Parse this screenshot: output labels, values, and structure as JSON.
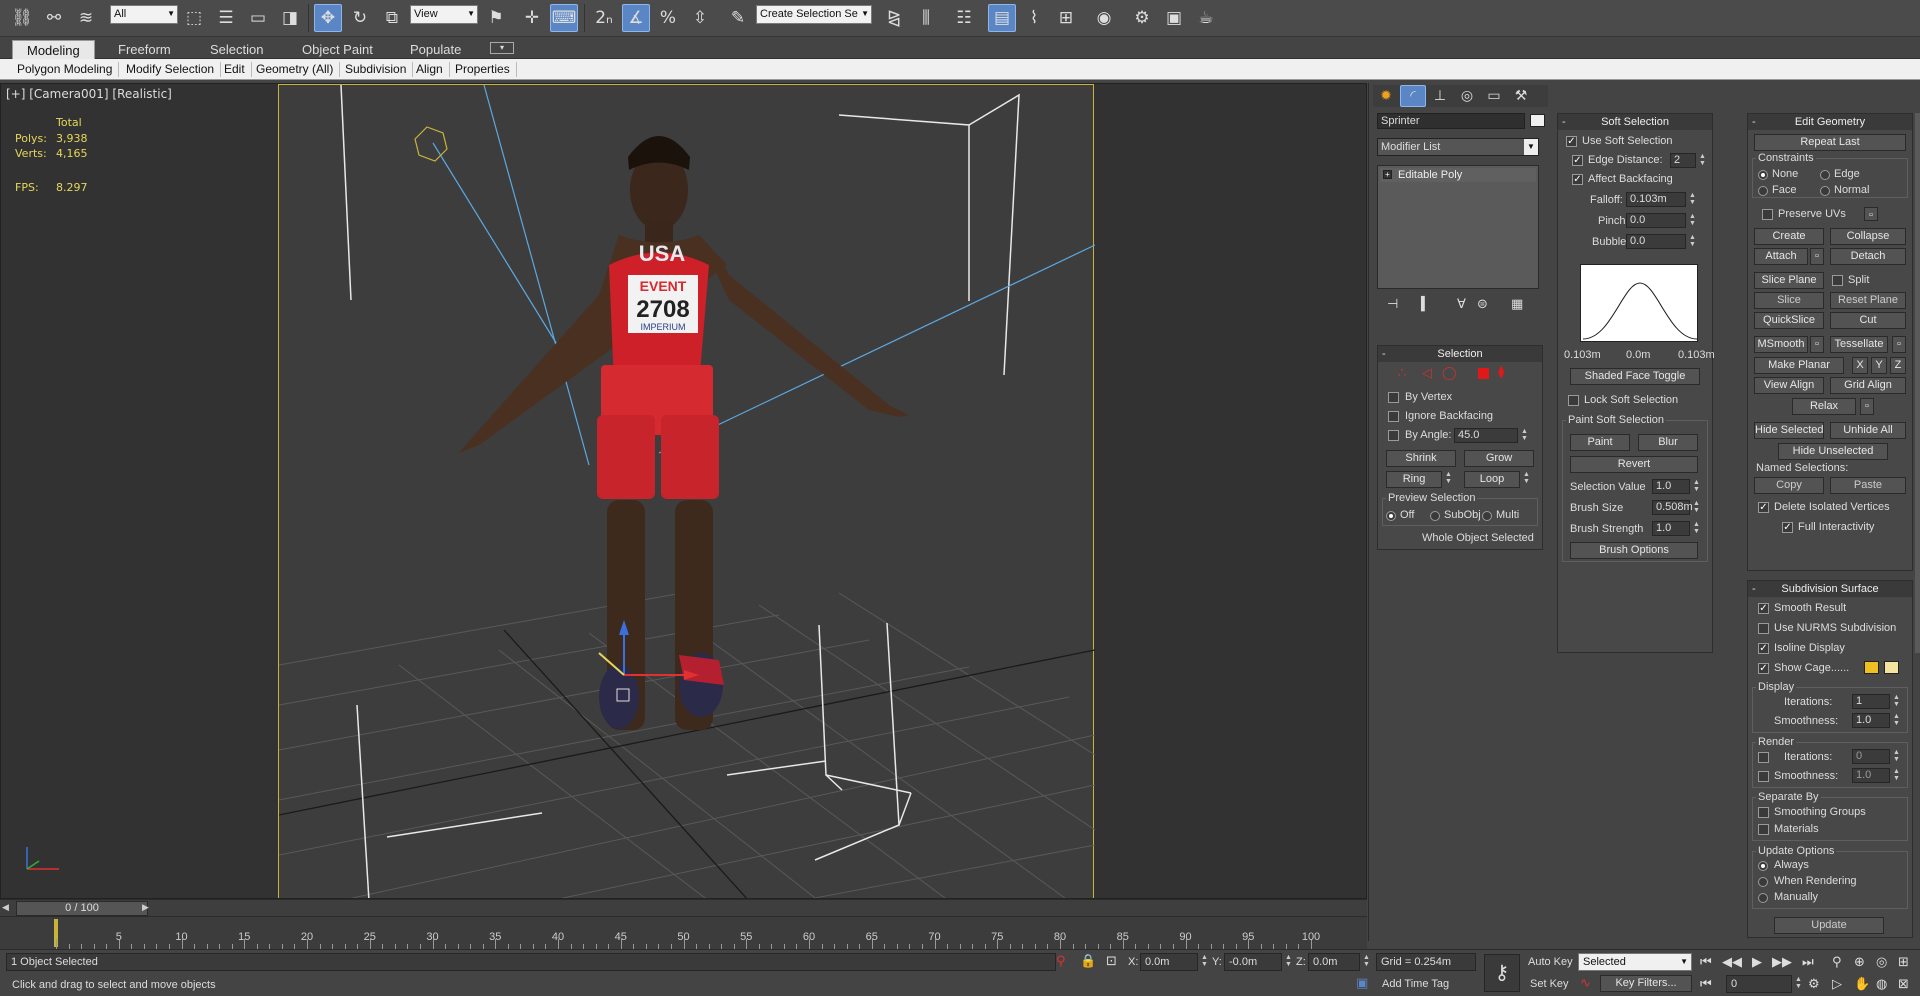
{
  "toolbar": {
    "selection_filter": "All",
    "ref_coord": "View",
    "named_selection_placeholder": "Create Selection Se"
  },
  "ribbon": {
    "tabs": [
      "Modeling",
      "Freeform",
      "Selection",
      "Object Paint",
      "Populate"
    ],
    "sub": [
      "Polygon Modeling",
      "Modify Selection",
      "Edit",
      "Geometry (All)",
      "Subdivision",
      "Align",
      "Properties"
    ]
  },
  "viewport": {
    "label": "[+] [Camera001] [Realistic]",
    "stats": {
      "total": "Total",
      "polys_label": "Polys:",
      "polys": "3,938",
      "verts_label": "Verts:",
      "verts": "4,165",
      "fps_label": "FPS:",
      "fps": "8.297"
    },
    "jersey": {
      "country": "USA",
      "event": "EVENT",
      "number": "2708",
      "sponsor": "IMPERIUM"
    }
  },
  "command_panel": {
    "object_name": "Sprinter",
    "modifier_list": "Modifier List",
    "stack_item": "Editable Poly",
    "selection": {
      "title": "Selection",
      "by_vertex": "By Vertex",
      "ignore_backfacing": "Ignore Backfacing",
      "by_angle": "By Angle:",
      "angle": "45.0",
      "shrink": "Shrink",
      "grow": "Grow",
      "ring": "Ring",
      "loop": "Loop",
      "preview": "Preview Selection",
      "off": "Off",
      "subobj": "SubObj",
      "multi": "Multi",
      "status": "Whole Object Selected"
    },
    "soft_selection": {
      "title": "Soft Selection",
      "use": "Use Soft Selection",
      "edge_distance": "Edge Distance:",
      "edge_value": "2",
      "affect_backfacing": "Affect Backfacing",
      "falloff": "Falloff:",
      "falloff_val": "0.103m",
      "pinch": "Pinch:",
      "pinch_val": "0.0",
      "bubble": "Bubble:",
      "bubble_val": "0.0",
      "curve_left": "0.103m",
      "curve_mid": "0.0m",
      "curve_right": "0.103m",
      "shaded_toggle": "Shaded Face Toggle",
      "lock": "Lock Soft Selection",
      "paint_group": "Paint Soft Selection",
      "paint": "Paint",
      "blur": "Blur",
      "revert": "Revert",
      "sel_value": "Selection Value",
      "sel_value_val": "1.0",
      "brush_size": "Brush Size",
      "brush_size_val": "0.508m",
      "brush_strength": "Brush Strength",
      "brush_strength_val": "1.0",
      "brush_options": "Brush Options"
    },
    "edit_geometry": {
      "title": "Edit Geometry",
      "repeat_last": "Repeat Last",
      "constraints": "Constraints",
      "none": "None",
      "edge": "Edge",
      "face": "Face",
      "normal": "Normal",
      "preserve_uvs": "Preserve UVs",
      "create": "Create",
      "collapse": "Collapse",
      "attach": "Attach",
      "detach": "Detach",
      "slice_plane": "Slice Plane",
      "split": "Split",
      "slice": "Slice",
      "reset_plane": "Reset Plane",
      "quickslice": "QuickSlice",
      "cut": "Cut",
      "msmooth": "MSmooth",
      "tessellate": "Tessellate",
      "make_planar": "Make Planar",
      "x": "X",
      "y": "Y",
      "z": "Z",
      "view_align": "View Align",
      "grid_align": "Grid Align",
      "relax": "Relax",
      "hide_selected": "Hide Selected",
      "unhide_all": "Unhide All",
      "hide_unselected": "Hide Unselected",
      "named_selections": "Named Selections:",
      "copy": "Copy",
      "paste": "Paste",
      "delete_isolated": "Delete Isolated Vertices",
      "full_interactivity": "Full Interactivity"
    },
    "subdivision_surface": {
      "title": "Subdivision Surface",
      "smooth_result": "Smooth Result",
      "use_nurms": "Use NURMS Subdivision",
      "isoline": "Isoline Display",
      "show_cage": "Show Cage......",
      "cage_color_1": "#f0c020",
      "cage_color_2": "#f3e2a0",
      "display": "Display",
      "iterations": "Iterations:",
      "iterations_val": "1",
      "smoothness": "Smoothness:",
      "smoothness_val": "1.0",
      "render": "Render",
      "r_iterations_val": "0",
      "r_smoothness_val": "1.0",
      "separate_by": "Separate By",
      "smoothing_groups": "Smoothing Groups",
      "materials": "Materials",
      "update_options": "Update Options",
      "always": "Always",
      "when_rendering": "When Rendering",
      "manually": "Manually",
      "update": "Update"
    }
  },
  "timeline": {
    "frame": "0 / 100",
    "current_frame": 0,
    "total_frames": 100,
    "ticks": [
      "5",
      "10",
      "15",
      "20",
      "25",
      "30",
      "35",
      "40",
      "45",
      "50",
      "55",
      "60",
      "65",
      "70",
      "75",
      "80",
      "85",
      "90",
      "95",
      "100"
    ]
  },
  "status": {
    "selected": "1 Object Selected",
    "prompt": "Click and drag to select and move objects",
    "x_label": "X:",
    "x": "0.0m",
    "y_label": "Y:",
    "y": "-0.0m",
    "z_label": "Z:",
    "z": "0.0m",
    "grid": "Grid = 0.254m",
    "add_time_tag": "Add Time Tag",
    "auto_key": "Auto Key",
    "set_key": "Set Key",
    "key_mode": "Selected",
    "key_filters": "Key Filters...",
    "frame_field": "0"
  },
  "colors": {
    "accent": "#5a86c5",
    "frame": "#c9b43a",
    "stats": "#e6d75a"
  }
}
